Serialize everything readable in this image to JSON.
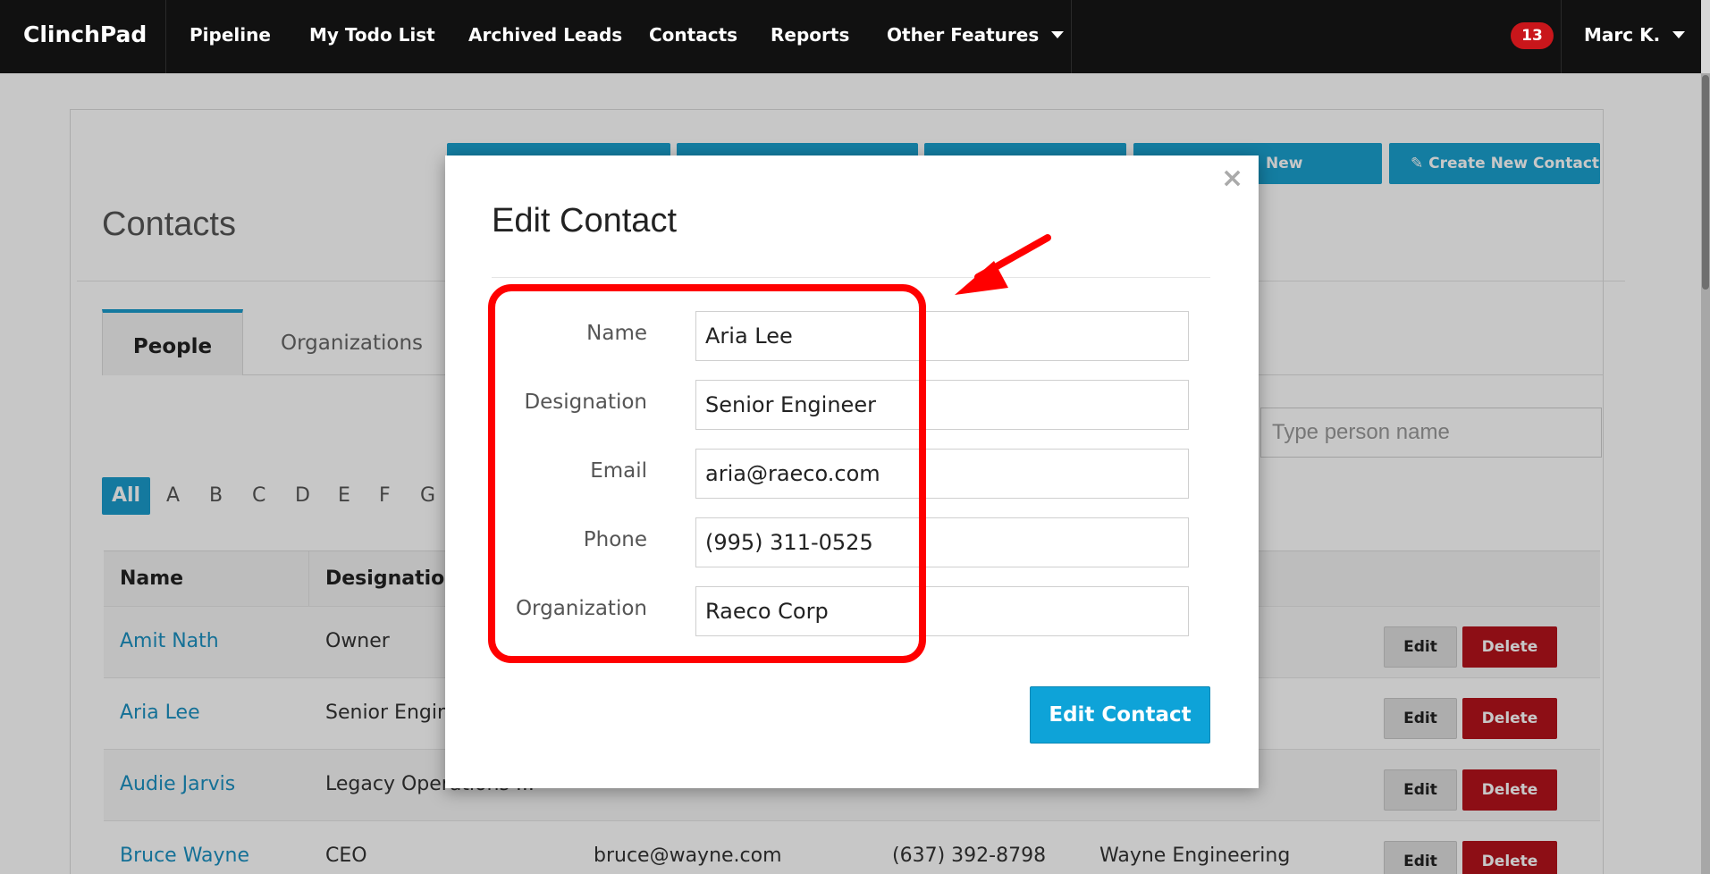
{
  "navbar": {
    "brand": "ClinchPad",
    "items": [
      "Pipeline",
      "My Todo List",
      "Archived Leads",
      "Contacts",
      "Reports",
      "Other Features"
    ],
    "notifications": "13",
    "user": "Marc K."
  },
  "toolbar": {
    "buttons": [
      "",
      "",
      "",
      "New Organization",
      "Create New Contact"
    ]
  },
  "page": {
    "title": "Contacts",
    "tabs": [
      "People",
      "Organizations"
    ],
    "search_placeholder": "Type person name",
    "alphabet": [
      "All",
      "A",
      "B",
      "C",
      "D",
      "E",
      "F",
      "G"
    ]
  },
  "table": {
    "headers": [
      "Name",
      "Designation"
    ],
    "rows": [
      {
        "name": "Amit Nath",
        "designation": "Owner",
        "email": "",
        "phone": "",
        "org": ""
      },
      {
        "name": "Aria Lee",
        "designation": "Senior Engin",
        "email": "",
        "phone": "",
        "org": ""
      },
      {
        "name": "Audie Jarvis",
        "designation": "Legacy Operations ...",
        "email": "",
        "phone": "",
        "org": ""
      },
      {
        "name": "Bruce Wayne",
        "designation": "CEO",
        "email": "bruce@wayne.com",
        "phone": "(637) 392-8798",
        "org": "Wayne Engineering"
      }
    ],
    "edit_label": "Edit",
    "delete_label": "Delete"
  },
  "modal": {
    "title": "Edit Contact",
    "close": "×",
    "fields": [
      {
        "label": "Name",
        "value": "Aria Lee"
      },
      {
        "label": "Designation",
        "value": "Senior Engineer"
      },
      {
        "label": "Email",
        "value": "aria@raeco.com"
      },
      {
        "label": "Phone",
        "value": "(995) 311-0525"
      },
      {
        "label": "Organization",
        "value": "Raeco Corp"
      }
    ],
    "submit": "Edit Contact"
  },
  "colors": {
    "accent": "#1a9ccc",
    "danger": "#b5121b",
    "highlight": "#ff0000"
  }
}
